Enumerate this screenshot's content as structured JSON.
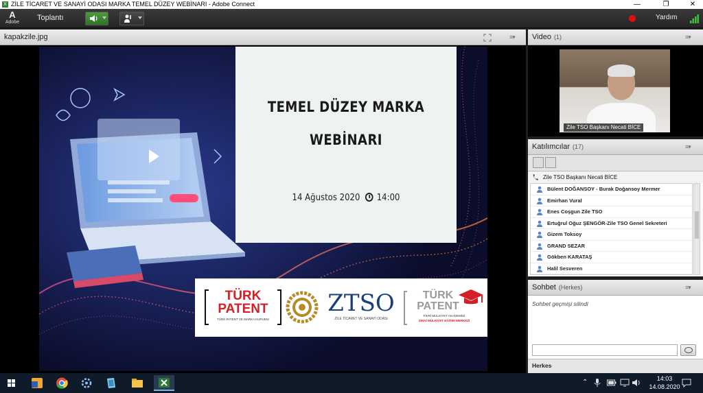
{
  "window": {
    "title": "ZİLE TİCARET VE SANAYİ ODASI MARKA TEMEL DÜZEY WEBİNARI - Adobe Connect",
    "minimize": "—",
    "maximize": "❐",
    "close": "✕"
  },
  "menubar": {
    "logo_label": "Adobe",
    "meeting_menu": "Toplantı",
    "help_menu": "Yardım",
    "record_color": "#e01010"
  },
  "share_pod": {
    "title": "kapakzile.jpg"
  },
  "slide": {
    "title_line1": "TEMEL DÜZEY MARKA",
    "title_line2": "WEBİNARI",
    "date": "14 Ağustos 2020",
    "time": "14:00",
    "logo1_line1": "TÜRK",
    "logo1_line2": "PATENT",
    "logo1_sub": "TÜRK PATENT VE MARKA KURUMU",
    "logo2_name": "ZTSO",
    "logo2_sub": "ZİLE TİCARET VE SANAYİ ODASI",
    "logo3_line1": "TÜRK",
    "logo3_line2": "PATENT",
    "logo3_sub1": "FİKRİ MÜLKİYET AKADEMİSİ",
    "logo3_sub2": "SINAİ MÜLKİYET EĞİTİM MERKEZİ",
    "brand_red": "#d31f26"
  },
  "video_pod": {
    "title": "Video",
    "count": "(1)",
    "speaker_label": "Zile TSO Başkanı Necati BİCE"
  },
  "attendees_pod": {
    "title": "Katılımcılar",
    "count": "(17)",
    "host": "Zile TSO Başkanı Necati BİCE",
    "list": [
      "Bülent DOĞANSOY - Burak Doğansoy Mermer",
      "Emirhan Vural",
      "Enes Coşgun Zile TSO",
      "Ertuğrul Oğuz ŞENGÖR-Zile TSO Genel Sekreteri",
      "Gizem Toksoy",
      "GRAND SEZAR",
      "Gökben KARATAŞ",
      "Halil Sesveren"
    ]
  },
  "chat_pod": {
    "title": "Sohbet",
    "scope": "(Herkes)",
    "message": "Sohbet geçmişi silindi",
    "recipient": "Herkes"
  },
  "taskbar": {
    "time": "14:03",
    "date": "14.08.2020"
  }
}
